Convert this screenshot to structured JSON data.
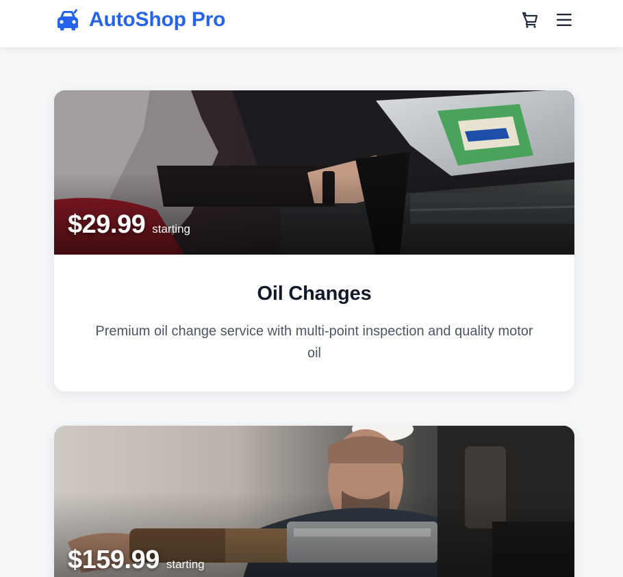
{
  "header": {
    "brand_name": "AutoShop Pro",
    "brand_icon": "car-icon",
    "cart_icon": "cart-icon",
    "menu_icon": "menu-icon",
    "brand_color": "#2563eb"
  },
  "services": [
    {
      "price": "$29.99",
      "price_suffix": "starting",
      "title": "Oil Changes",
      "description": "Premium oil change service with multi-point inspection and quality motor oil"
    },
    {
      "price": "$159.99",
      "price_suffix": "starting"
    }
  ]
}
